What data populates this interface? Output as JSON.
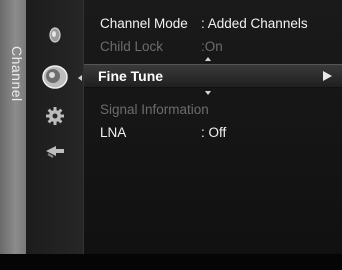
{
  "sidebar": {
    "label": "Channel"
  },
  "icons": [
    "picture-icon",
    "channel-dish-icon",
    "setup-gear-icon",
    "input-icon"
  ],
  "menu": {
    "items": [
      {
        "label": "Channel Mode",
        "value": ": Added Channels"
      },
      {
        "label": "Child Lock",
        "value": ":On"
      },
      {
        "label": "Fine Tune",
        "value": ""
      },
      {
        "label": "Signal Information",
        "value": ""
      },
      {
        "label": "LNA",
        "value": ": Off"
      }
    ]
  },
  "colors": {
    "text": "#f2f2f2",
    "disabled": "#6c6c6c",
    "sidebar": "#7a7a7a",
    "background": "#141414"
  }
}
